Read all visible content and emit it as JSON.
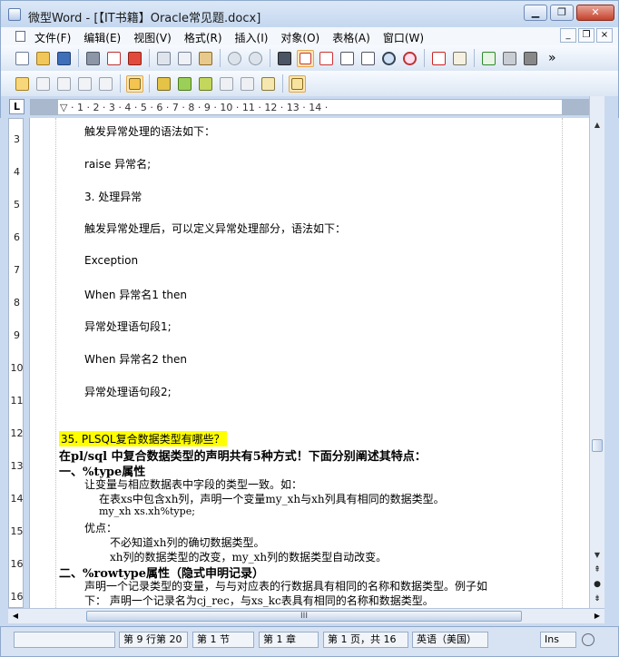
{
  "window": {
    "title": "微型Word - [【IT书籍】Oracle常见题.docx]",
    "minimize": "▁",
    "restore": "❐",
    "close": "✕"
  },
  "menu": {
    "items": [
      "文件(F)",
      "编辑(E)",
      "视图(V)",
      "格式(R)",
      "插入(I)",
      "对象(O)",
      "表格(A)",
      "窗口(W)"
    ],
    "mdi_min": "_",
    "mdi_restore": "❐",
    "mdi_close": "×"
  },
  "toolbar1": {
    "icons": [
      "new-document-icon",
      "open-folder-icon",
      "save-icon",
      "print-icon",
      "print-preview-icon",
      "pdf-icon",
      "cut-icon",
      "copy-icon",
      "paste-icon",
      "undo-icon",
      "redo-icon",
      "find-icon",
      "actual-size-icon",
      "page-view-icon",
      "web-view-icon",
      "outline-view-icon",
      "zoom-icon",
      "zoom-percent-icon",
      "font-color-icon",
      "style-icon",
      "spellcheck-icon",
      "chart-icon",
      "grayscale-icon"
    ],
    "more": "»"
  },
  "toolbar2": {
    "icons": [
      "insert-note-icon",
      "edit-note-icon",
      "delete-note-icon",
      "prev-note-icon",
      "next-note-icon",
      "note-panel-icon",
      "accept-change-icon",
      "accept-all-icon",
      "reject-change-icon",
      "reject-all-icon",
      "track-changes-icon",
      "review-panel-icon",
      "compare-icon"
    ]
  },
  "ruler": {
    "corner": "L",
    "ticks": "▽ · 1 · 2 · 3 · 4 · 5 · 6 · 7 · 8 · 9 · 10 · 11 · 12 · 13 · 14 ·",
    "vertical_numbers": [
      "3",
      "4",
      "5",
      "6",
      "7",
      "8",
      "9",
      "10",
      "11",
      "12",
      "13",
      "14",
      "15",
      "16"
    ]
  },
  "document": {
    "lines": [
      "触发异常处理的语法如下：",
      "raise 异常名;",
      "3. 处理异常",
      "触发异常处理后，可以定义异常处理部分，语法如下：",
      "Exception",
      "When 异常名1 then",
      "异常处理语句段1;",
      "When 异常名2 then",
      "异常处理语句段2;"
    ],
    "highlight": "35.  PLSQL复合数据类型有哪些？",
    "heading": "在pl/sql 中复合数据类型的声明共有5种方式！下面分别阐述其特点：",
    "section1_title": "一、%type属性",
    "s1_l1": "让变量与相应数据表中字段的类型一致。如：",
    "s1_l2": "在表xs中包含xh列，声明一个变量my_xh与xh列具有相同的数据类型。",
    "s1_l3": "my_xh xs.xh%type;",
    "s1_l4": "优点：",
    "s1_l5": "不必知道xh列的确切数据类型。",
    "s1_l6": "xh列的数据类型的改变，my_xh列的数据类型自动改变。",
    "section2_title": "二、%rowtype属性（隐式申明记录）",
    "s2_l1": "声明一个记录类型的变量，与与对应表的行数据具有相同的名称和数据类型。例子如",
    "s2_l2": "下：  声明一个记录名为cj_rec，与xs_kc表具有相同的名称和数据类型。"
  },
  "scroll": {
    "up": "▲",
    "down": "▼",
    "prev_page": "⇞",
    "select_browse": "●",
    "next_page": "⇟",
    "left": "◀",
    "right": "▶",
    "grip": "III"
  },
  "status": {
    "row_col": "第 9 行第 20",
    "section": "第 1 节",
    "chapter": "第 1 章",
    "page": "第 1 页，共 16",
    "language": "英语（美国）",
    "insert_mode": "Ins"
  }
}
